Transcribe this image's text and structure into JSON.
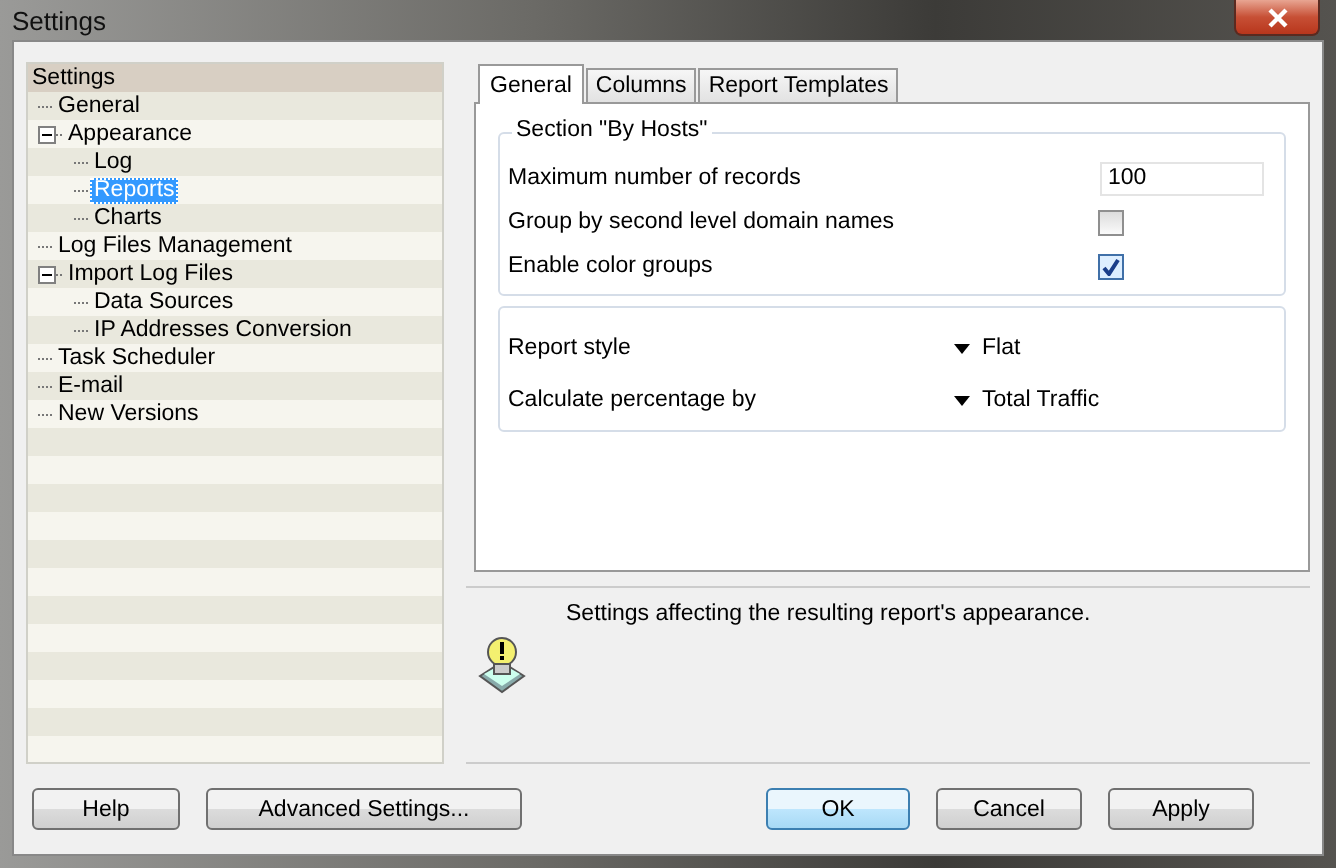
{
  "window": {
    "title": "Settings"
  },
  "tree": {
    "root": "Settings",
    "items": [
      {
        "label": "General",
        "selected": false
      },
      {
        "label": "Appearance",
        "selected": false,
        "expanded": true,
        "children": [
          {
            "label": "Log",
            "selected": false
          },
          {
            "label": "Reports",
            "selected": true
          },
          {
            "label": "Charts",
            "selected": false
          }
        ]
      },
      {
        "label": "Log Files Management",
        "selected": false
      },
      {
        "label": "Import Log Files",
        "selected": false,
        "expanded": true,
        "children": [
          {
            "label": "Data Sources",
            "selected": false
          },
          {
            "label": "IP Addresses Conversion",
            "selected": false
          }
        ]
      },
      {
        "label": "Task Scheduler",
        "selected": false
      },
      {
        "label": "E-mail",
        "selected": false
      },
      {
        "label": "New Versions",
        "selected": false
      }
    ]
  },
  "tabs": [
    {
      "label": "General",
      "selected": true
    },
    {
      "label": "Columns",
      "selected": false
    },
    {
      "label": "Report Templates",
      "selected": false
    }
  ],
  "section": {
    "title": "Section \"By Hosts\"",
    "rows": [
      {
        "kind": "number",
        "label": "Maximum number of records",
        "value": "100"
      },
      {
        "kind": "checkbox",
        "label": "Group by second level domain names",
        "checked": false
      },
      {
        "kind": "checkbox",
        "label": "Enable color groups",
        "checked": true
      }
    ]
  },
  "options": [
    {
      "label": "Report style",
      "value": "Flat"
    },
    {
      "label": "Calculate percentage by",
      "value": "Total Traffic"
    }
  ],
  "hint": "Settings affecting the resulting report's appearance.",
  "buttons": [
    {
      "label": "Help",
      "default": false
    },
    {
      "label": "Advanced Settings...",
      "default": false
    },
    {
      "label": "OK",
      "default": true
    },
    {
      "label": "Cancel",
      "default": false
    },
    {
      "label": "Apply",
      "default": false
    }
  ]
}
